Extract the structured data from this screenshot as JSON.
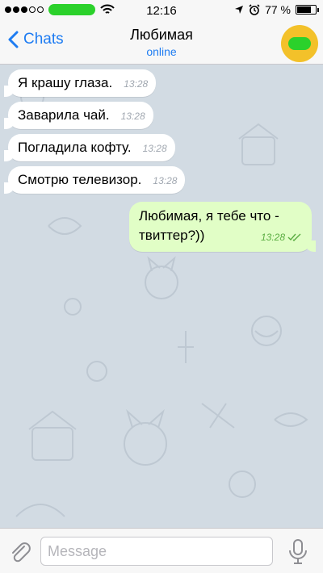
{
  "status_bar": {
    "time": "12:16",
    "battery": "77 %",
    "battery_level": 0.77,
    "signal_bars_filled": 3,
    "signal_bars_total": 5
  },
  "header": {
    "back_label": "Chats",
    "contact_name": "Любимая",
    "contact_status": "online"
  },
  "messages": [
    {
      "text": "Я крашу глаза.",
      "time": "13:28",
      "direction": "in"
    },
    {
      "text": "Заварила чай.",
      "time": "13:28",
      "direction": "in"
    },
    {
      "text": "Погладила кофту.",
      "time": "13:28",
      "direction": "in"
    },
    {
      "text": "Смотрю телевизор.",
      "time": "13:28",
      "direction": "in"
    },
    {
      "text": "Любимая, я тебе что - твиттер?))",
      "time": "13:28",
      "direction": "out"
    }
  ],
  "input": {
    "placeholder": "Message",
    "value": ""
  },
  "colors": {
    "accent": "#1e7cf2",
    "incoming_bubble": "#ffffff",
    "outgoing_bubble": "#e1fec6",
    "chat_background": "#d2dbe3",
    "avatar": "#f3c12a"
  },
  "icons": {
    "back": "chevron-left-icon",
    "wifi": "wifi-icon",
    "location": "location-arrow-icon",
    "alarm": "alarm-clock-icon",
    "attach": "paperclip-icon",
    "mic": "microphone-icon",
    "read_receipt": "double-check-icon"
  }
}
